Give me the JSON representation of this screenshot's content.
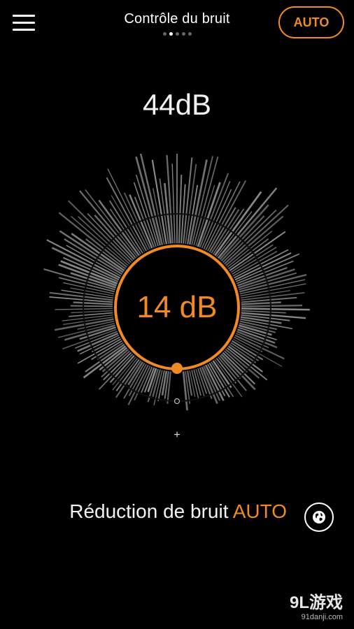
{
  "header": {
    "title": "Contrôle du bruit",
    "auto_label": "AUTO",
    "pages": {
      "count": 5,
      "active": 1
    }
  },
  "ambient": {
    "level": "44dB"
  },
  "dial": {
    "value": "14 dB",
    "minus_symbol": "○",
    "plus_symbol": "+"
  },
  "footer": {
    "label": "Réduction de bruit",
    "mode": "AUTO"
  },
  "watermark": {
    "brand": "9L游戏",
    "url": "91danji.com"
  },
  "colors": {
    "accent": "#f08a24",
    "background": "#000000",
    "text": "#ffffff",
    "spikes": "#8c8c8c"
  },
  "icons": {
    "menu": "menu-icon",
    "language": "globe-icon"
  }
}
